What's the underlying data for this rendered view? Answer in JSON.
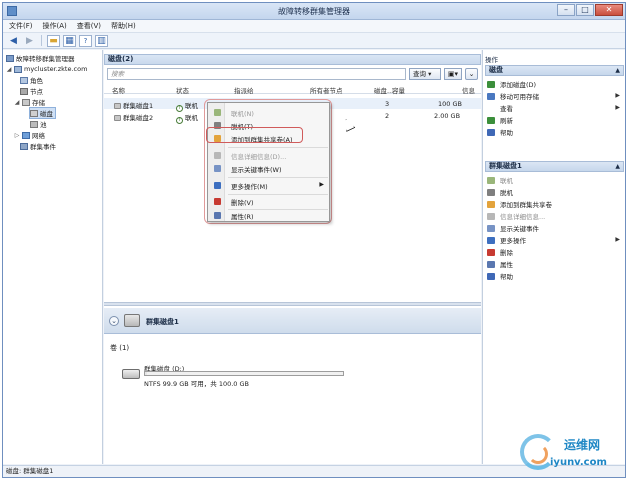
{
  "window": {
    "title": "故障转移群集管理器"
  },
  "menu": [
    "文件(F)",
    "操作(A)",
    "查看(V)",
    "帮助(H)"
  ],
  "tree": {
    "root": "故障转移群集管理器",
    "cluster": "mycluster.zkte.com",
    "items": {
      "roles": "角色",
      "nodes": "节点",
      "storage": "存储",
      "disks": "磁盘",
      "pools": "池",
      "networks": "网络",
      "events": "群集事件"
    }
  },
  "center": {
    "header": "磁盘(2)",
    "search_placeholder": "搜索",
    "query_label": "查询",
    "columns": [
      "名称",
      "状态",
      "指派给",
      "所有者节点",
      "磁盘...",
      "容量",
      "信息"
    ],
    "rows": [
      {
        "name": "群集磁盘1",
        "status": "联机",
        "disk_no": "3",
        "capacity": "100 GB"
      },
      {
        "name": "群集磁盘2",
        "status": "联机",
        "disk_no": "2",
        "capacity": "2.00 GB"
      }
    ],
    "detail": {
      "title": "群集磁盘1",
      "volume_label": "卷 (1)",
      "volume_name": "群集磁盘 (D:)",
      "volume_info": "NTFS 99.9 GB 可用，共 100.0 GB",
      "volume_used_fraction": 0.001
    }
  },
  "context_menu": [
    {
      "label": "联机(N)",
      "disabled": true,
      "color": "#9ab67a"
    },
    {
      "label": "脱机(T)",
      "disabled": false,
      "color": "#7f7f7f"
    },
    {
      "label": "添加到群集共享卷(A)",
      "disabled": false,
      "color": "#e3a33c"
    },
    {
      "label": "信息详细信息(D)...",
      "disabled": true,
      "color": "#b7b7b7"
    },
    {
      "label": "显示关键事件(W)",
      "disabled": false,
      "color": "#7793c5"
    },
    {
      "label": "更多操作(M)",
      "disabled": false,
      "color": "#3d6fc0",
      "submenu": true
    },
    {
      "label": "删除(V)",
      "disabled": false,
      "color": "#c73a32"
    },
    {
      "label": "属性(R)",
      "disabled": false,
      "color": "#5a77b0"
    }
  ],
  "actions": {
    "header": "操作",
    "section1": {
      "title": "磁盘",
      "items": [
        {
          "label": "添加磁盘(D)",
          "color": "#3b8f3b"
        },
        {
          "label": "移动可用存储",
          "color": "#4a78c0",
          "submenu": true
        },
        {
          "label": "查看",
          "color": "#ffffff",
          "submenu": true
        },
        {
          "label": "刷新",
          "color": "#3b8f3b"
        },
        {
          "label": "帮助",
          "color": "#3f68b6"
        }
      ]
    },
    "section2": {
      "title": "群集磁盘1",
      "items": [
        {
          "label": "联机",
          "color": "#9ab67a",
          "disabled": true
        },
        {
          "label": "脱机",
          "color": "#7f7f7f"
        },
        {
          "label": "添加到群集共享卷",
          "color": "#e3a33c"
        },
        {
          "label": "信息详细信息...",
          "color": "#b7b7b7",
          "disabled": true
        },
        {
          "label": "显示关键事件",
          "color": "#7793c5"
        },
        {
          "label": "更多操作",
          "color": "#3d6fc0",
          "submenu": true
        },
        {
          "label": "删除",
          "color": "#c73a32"
        },
        {
          "label": "属性",
          "color": "#5a77b0"
        },
        {
          "label": "帮助",
          "color": "#3f68b6"
        }
      ]
    }
  },
  "statusbar": "磁盘: 群集磁盘1",
  "watermark": {
    "brand": "运维网",
    "site": "iyunv.com"
  }
}
